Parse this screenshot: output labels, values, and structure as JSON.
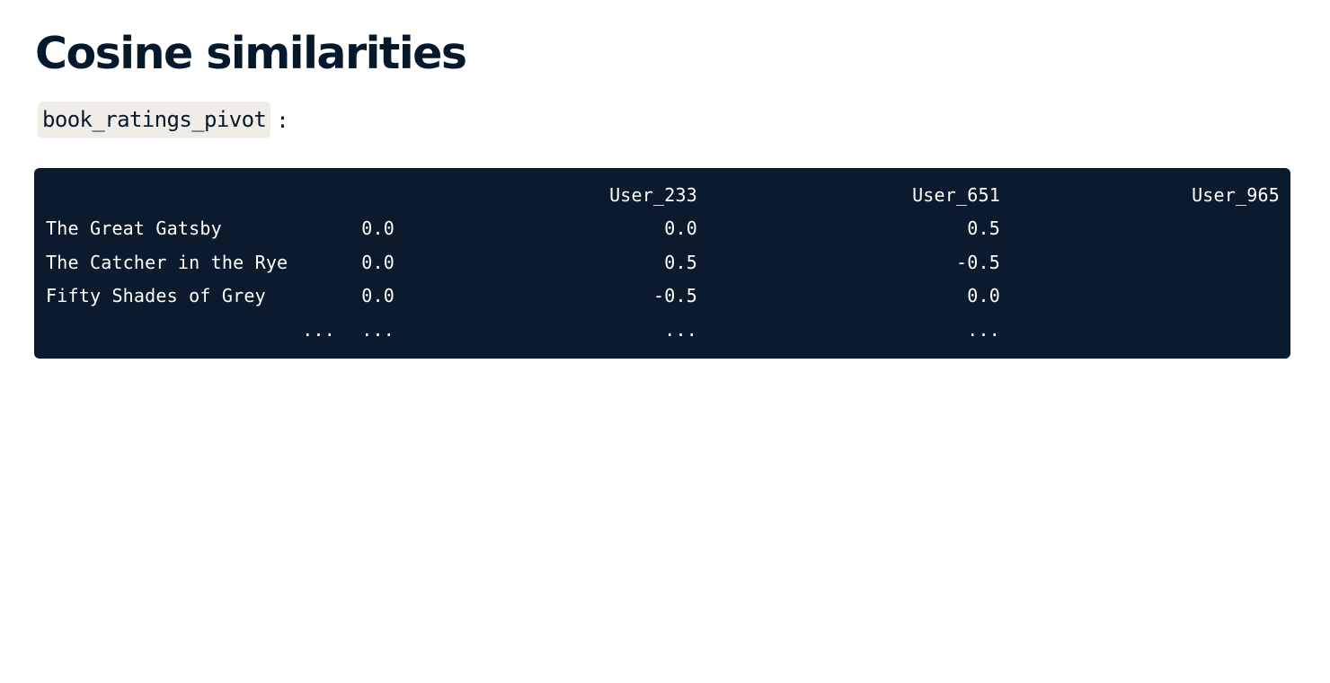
{
  "title": "Cosine similarities",
  "variable": {
    "name": "book_ratings_pivot",
    "suffix": ":"
  },
  "table": {
    "columns": [
      "User_233",
      "User_651",
      "User_965"
    ],
    "rows": [
      {
        "index": "The Great Gatsby",
        "values": [
          "0.0",
          "0.0",
          "0.5"
        ]
      },
      {
        "index": "The Catcher in the Rye",
        "values": [
          "0.0",
          "0.5",
          "-0.5"
        ]
      },
      {
        "index": "Fifty Shades of Grey",
        "values": [
          "0.0",
          "-0.5",
          "0.0"
        ]
      },
      {
        "index": "...",
        "values": [
          "...",
          "...",
          "..."
        ]
      }
    ]
  }
}
